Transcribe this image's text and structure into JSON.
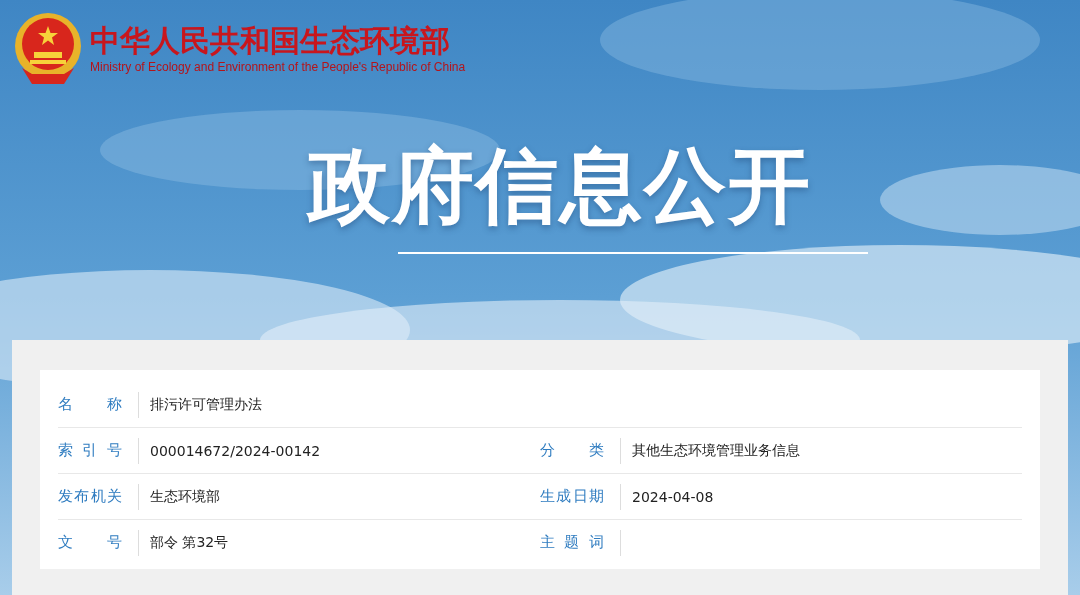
{
  "header": {
    "logo_title": "中华人民共和国生态环境部",
    "logo_subtitle": "Ministry of Ecology and Environment of the People's Republic of China",
    "page_title": "政府信息公开"
  },
  "details": [
    {
      "fields": [
        {
          "label": "名 称",
          "value": "排污许可管理办法"
        }
      ]
    },
    {
      "fields": [
        {
          "label": "索 引 号",
          "value": "000014672/2024-00142"
        },
        {
          "label": "分 类",
          "value": "其他生态环境管理业务信息"
        }
      ]
    },
    {
      "fields": [
        {
          "label": "发布机关",
          "value": "生态环境部"
        },
        {
          "label": "生成日期",
          "value": "2024-04-08"
        }
      ]
    },
    {
      "fields": [
        {
          "label": "文 号",
          "value": "部令 第32号"
        },
        {
          "label": "主 题 词"
        }
      ]
    }
  ]
}
